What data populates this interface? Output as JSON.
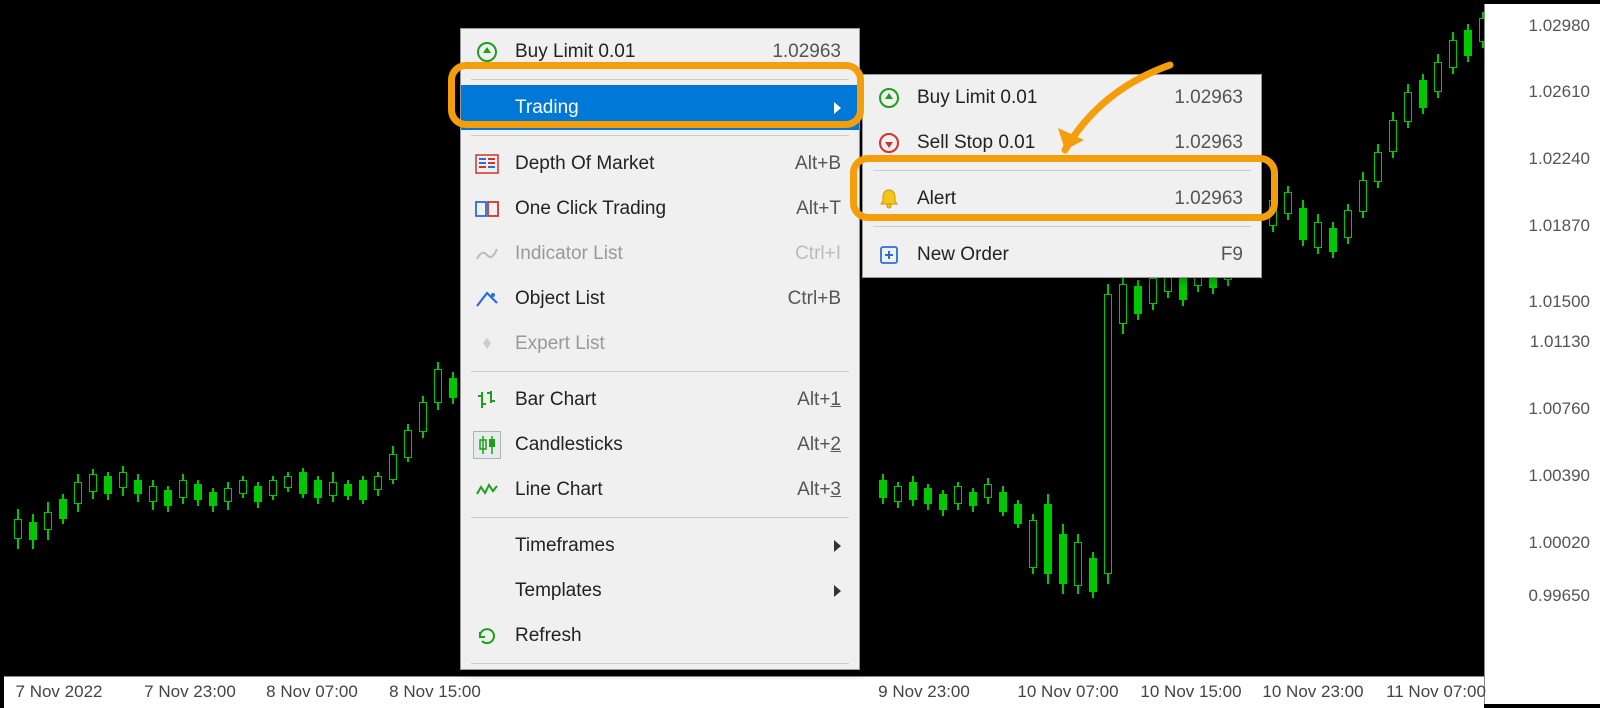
{
  "y_ticks": [
    "1.02980",
    "1.02610",
    "1.02240",
    "1.01870",
    "1.01500",
    "1.01130",
    "1.00760",
    "1.00390",
    "1.00020",
    "0.99650"
  ],
  "x_ticks": [
    "7 Nov 2022",
    "7 Nov 23:00",
    "8 Nov 07:00",
    "8 Nov 15:00",
    "9 Nov 23:00",
    "10 Nov 07:00",
    "10 Nov 15:00",
    "10 Nov 23:00",
    "11 Nov 07:00"
  ],
  "main_menu": {
    "buy_limit": {
      "label": "Buy Limit 0.01",
      "price": "1.02963"
    },
    "trading": "Trading",
    "depth": {
      "label": "Depth Of Market",
      "shortcut": "Alt+B"
    },
    "one_click": {
      "label": "One Click Trading",
      "shortcut": "Alt+T"
    },
    "indicator_list": {
      "label": "Indicator List",
      "shortcut": "Ctrl+I"
    },
    "object_list": {
      "label": "Object List",
      "shortcut": "Ctrl+B"
    },
    "expert_list": "Expert List",
    "bar_chart": {
      "label": "Bar Chart",
      "shortcut": "Alt+"
    },
    "candlesticks": {
      "label": "Candlesticks",
      "shortcut": "Alt+"
    },
    "line_chart": {
      "label": "Line Chart",
      "shortcut": "Alt+"
    },
    "timeframes": "Timeframes",
    "templates": "Templates",
    "refresh": "Refresh"
  },
  "sub_menu": {
    "buy_limit": {
      "label": "Buy Limit 0.01",
      "price": "1.02963"
    },
    "sell_stop": {
      "label": "Sell Stop 0.01",
      "price": "1.02963"
    },
    "alert": {
      "label": "Alert",
      "price": "1.02963"
    },
    "new_order": {
      "label": "New Order",
      "shortcut": "F9"
    }
  }
}
